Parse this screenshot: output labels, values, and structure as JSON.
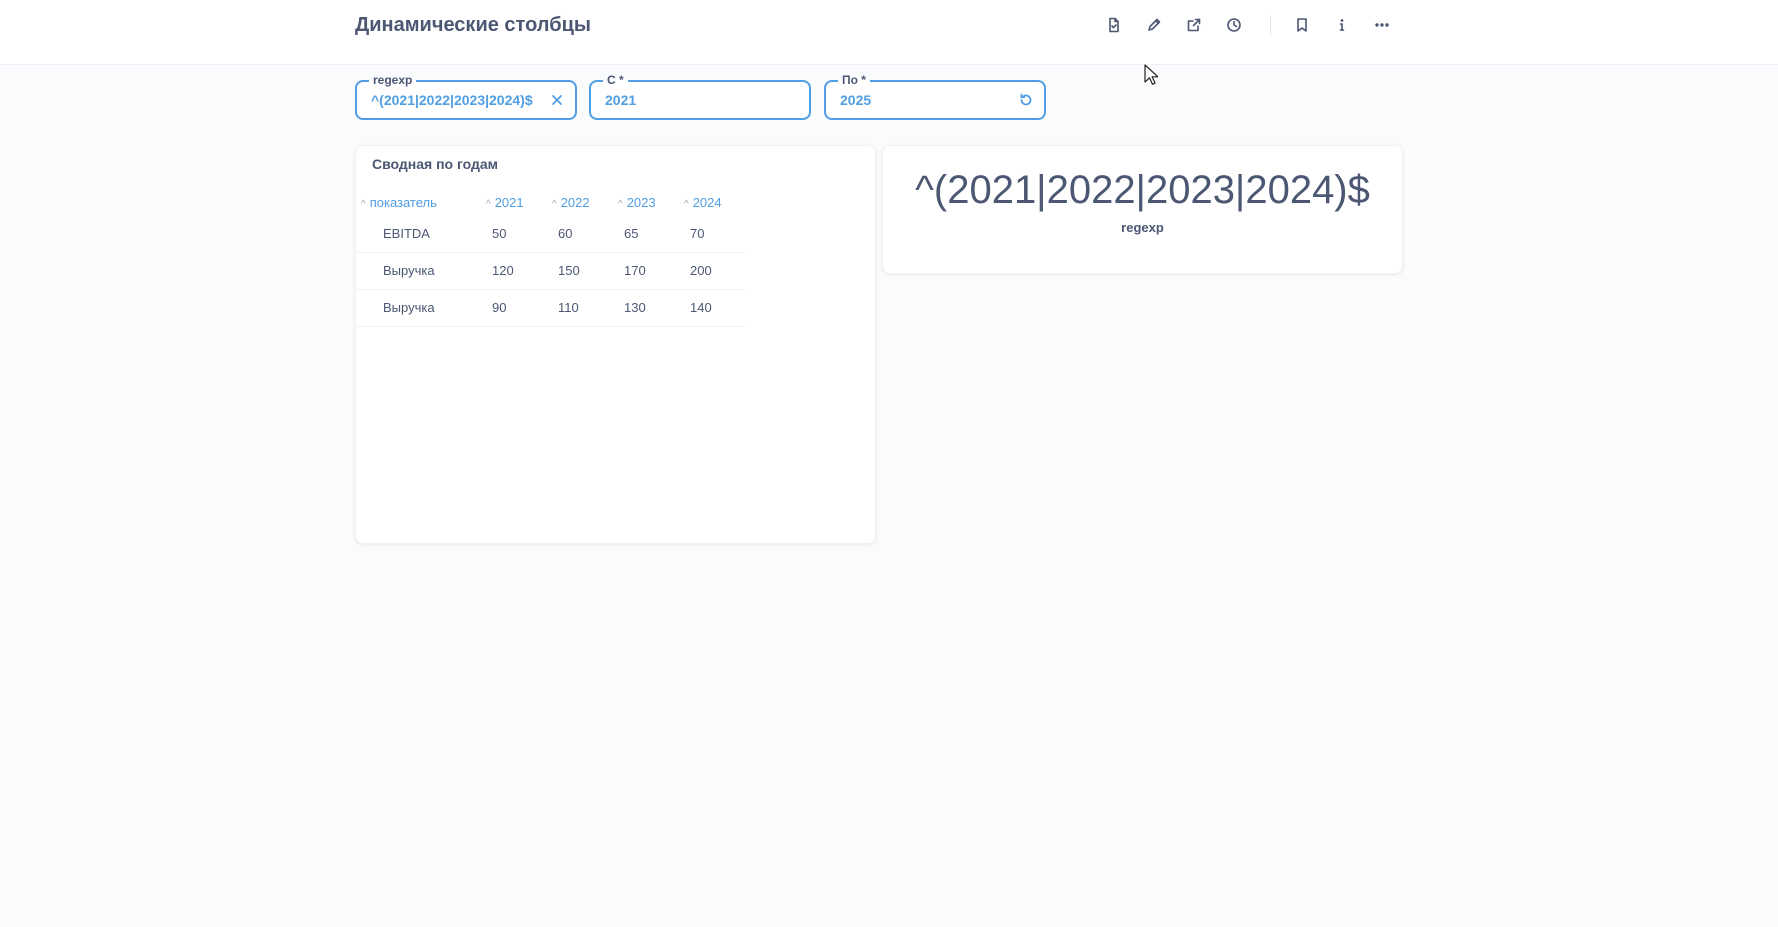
{
  "header": {
    "title": "Динамические столбцы",
    "toolbar": [
      {
        "icon": "document-icon"
      },
      {
        "icon": "pencil-icon"
      },
      {
        "icon": "share-icon"
      },
      {
        "icon": "clock-icon"
      },
      {
        "icon": "bookmark-icon"
      },
      {
        "icon": "info-icon"
      },
      {
        "icon": "more-icon"
      }
    ]
  },
  "filters": [
    {
      "label": "regexp",
      "value": "^(2021|2022|2023|2024)$",
      "icon": "close-icon"
    },
    {
      "label": "С *",
      "value": "2021"
    },
    {
      "label": "По *",
      "value": "2025",
      "icon": "reset-icon"
    }
  ],
  "table_card": {
    "title": "Сводная по годам",
    "sort_glyph": "^",
    "columns": [
      "показатель",
      "2021",
      "2022",
      "2023",
      "2024"
    ],
    "rows": [
      [
        "EBITDA",
        "50",
        "60",
        "65",
        "70"
      ],
      [
        "Выручка",
        "120",
        "150",
        "170",
        "200"
      ],
      [
        "Выручка",
        "90",
        "110",
        "130",
        "140"
      ]
    ]
  },
  "scalar_card": {
    "value": "^(2021|2022|2023|2024)$",
    "label": "regexp"
  },
  "colors": {
    "accent": "#509ee3",
    "text": "#4c5773",
    "background": "#f9fbfc"
  }
}
